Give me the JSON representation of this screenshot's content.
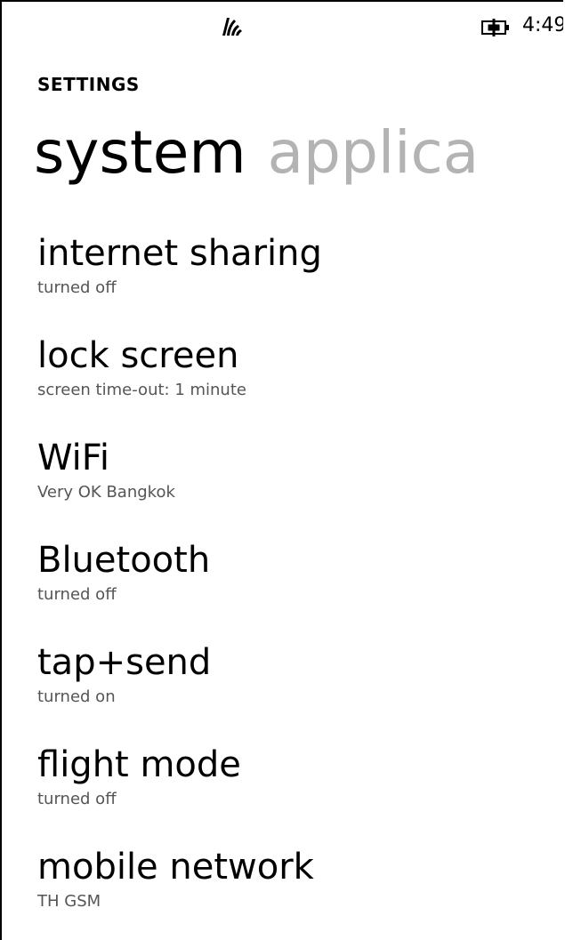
{
  "colors": {
    "background": "#ffffff",
    "text": "#000000",
    "subtext": "#555555",
    "inactive_pivot": "#b3b3b3"
  },
  "status_bar": {
    "signal_icon": "wifi-signal-icon",
    "battery_icon": "battery-charging-icon",
    "time": "4:49"
  },
  "app_title": "SETTINGS",
  "pivot": {
    "items": [
      {
        "label": "system",
        "active": true
      },
      {
        "label": "applica",
        "active": false
      }
    ]
  },
  "settings": [
    {
      "title": "internet sharing",
      "subtitle": "turned off"
    },
    {
      "title": "lock screen",
      "subtitle": "screen time-out: 1 minute"
    },
    {
      "title": "WiFi",
      "subtitle": "Very OK Bangkok"
    },
    {
      "title": "Bluetooth",
      "subtitle": "turned off"
    },
    {
      "title": "tap+send",
      "subtitle": "turned on"
    },
    {
      "title": "flight mode",
      "subtitle": "turned off"
    },
    {
      "title": "mobile network",
      "subtitle": "TH GSM"
    }
  ]
}
